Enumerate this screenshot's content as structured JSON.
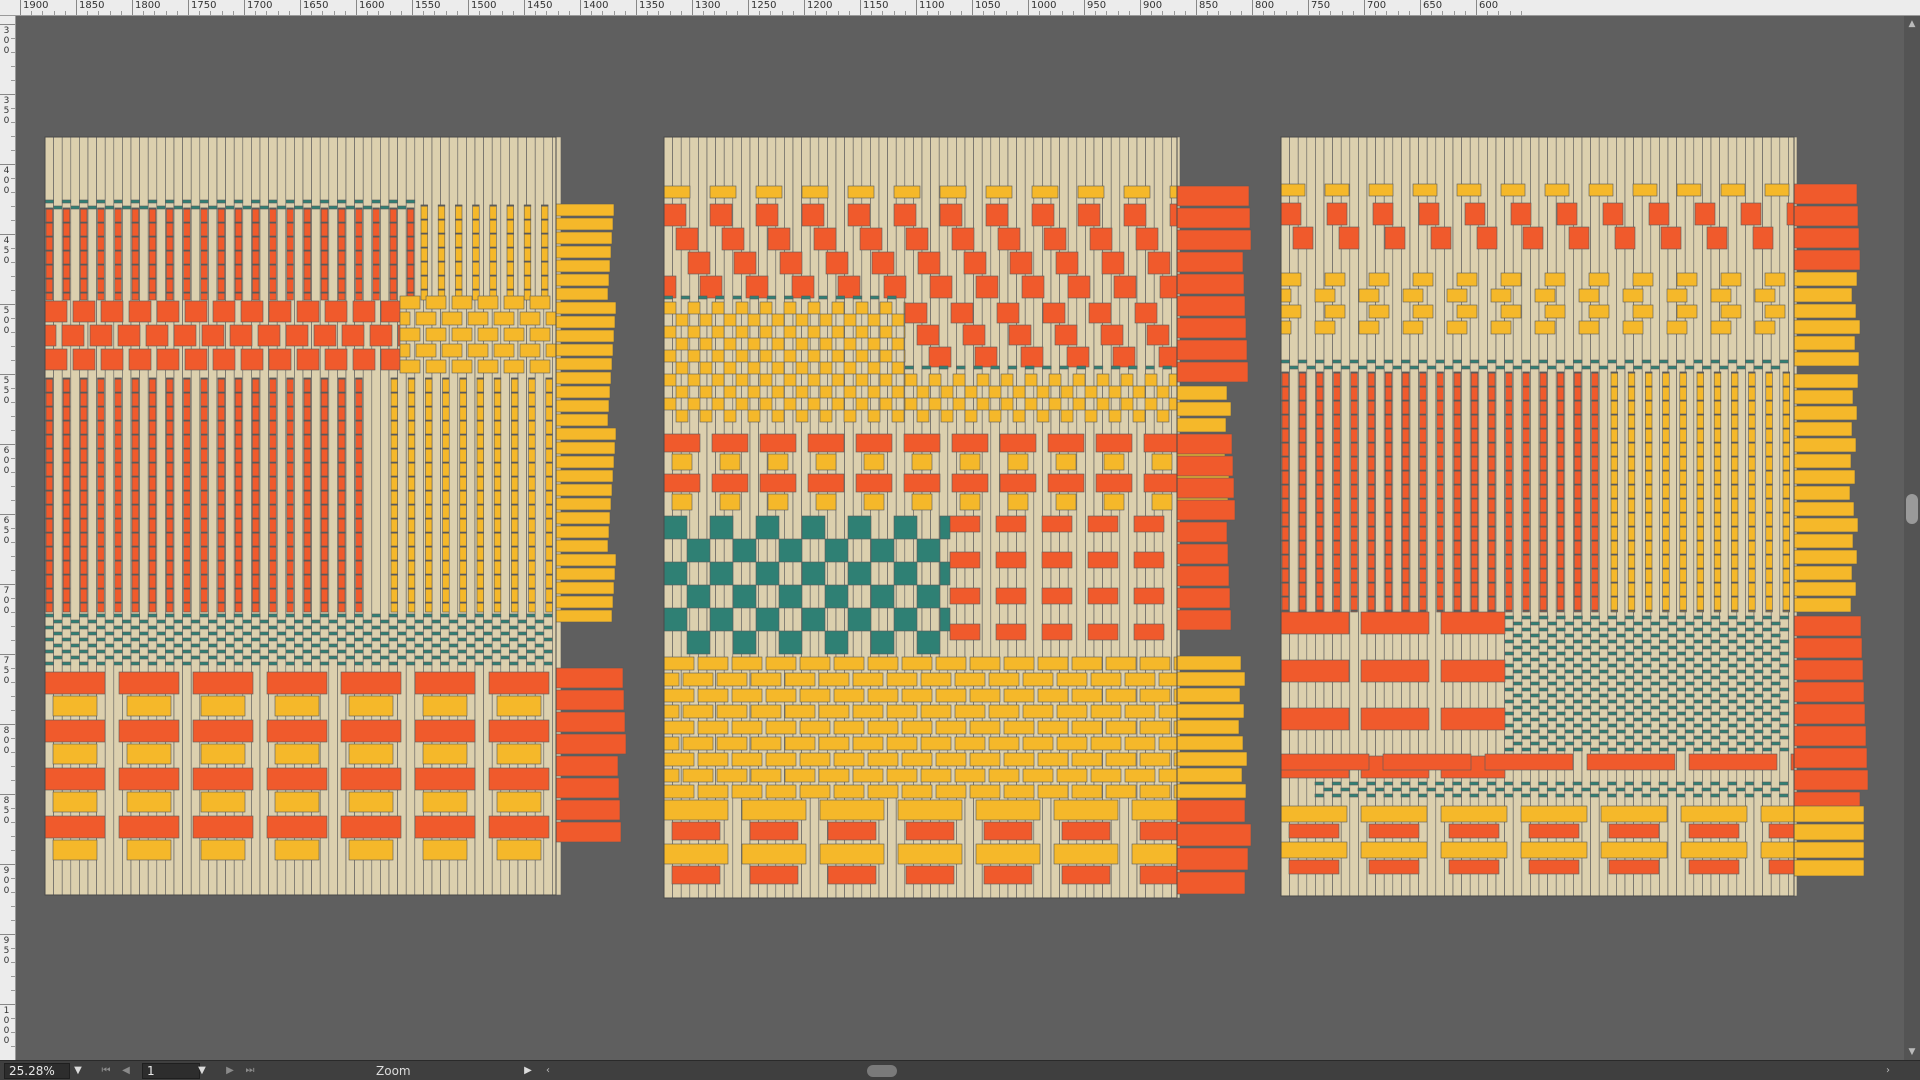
{
  "ruler": {
    "top_labels": [
      "1900",
      "1850",
      "1800",
      "1750",
      "1700",
      "1650",
      "1600",
      "1550",
      "1500",
      "1450",
      "1400",
      "1350",
      "1300",
      "1250",
      "1200",
      "1150",
      "1100",
      "1050",
      "1000",
      "950",
      "900",
      "850",
      "800",
      "750",
      "700",
      "650",
      "600"
    ],
    "left_labels": [
      "300",
      "350",
      "400",
      "450",
      "500",
      "550",
      "600",
      "650",
      "700",
      "750",
      "800",
      "850",
      "900",
      "950",
      "1000"
    ]
  },
  "colors": {
    "canvas_bg": "#5f5f5f",
    "warp": "#dcd0ae",
    "orange": "#f05a2c",
    "yellow": "#f5b82a",
    "teal": "#2f8074",
    "outline": "#5a5a5a"
  },
  "statusbar": {
    "zoom_value": "25.28%",
    "page_value": "1",
    "zoom_label": "Zoom"
  },
  "icons": {
    "zoom_dropdown": "chevron-down-icon",
    "first_page": "first-page-icon",
    "prev_page": "prev-page-icon",
    "next_page": "next-page-icon",
    "last_page": "last-page-icon",
    "page_dropdown": "chevron-down-icon",
    "scroll_right": "triangle-right-icon",
    "scroll_left": "chevron-left-icon",
    "scroll_end": "chevron-right-icon"
  }
}
